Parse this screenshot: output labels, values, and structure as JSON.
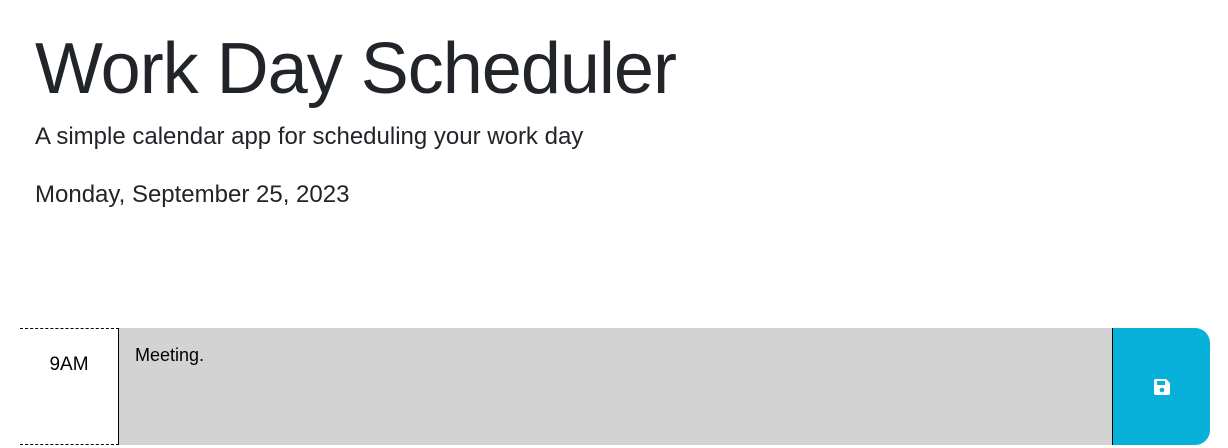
{
  "header": {
    "title": "Work Day Scheduler",
    "subtitle": "A simple calendar app for scheduling your work day",
    "current_date": "Monday, September 25, 2023"
  },
  "time_blocks": [
    {
      "hour": "9AM",
      "description": "Meeting.",
      "status": "past",
      "save_icon": "floppy-disk-icon"
    }
  ],
  "colors": {
    "past": "#d3d3d3",
    "save_button": "#06b0d8",
    "text": "#212529"
  }
}
